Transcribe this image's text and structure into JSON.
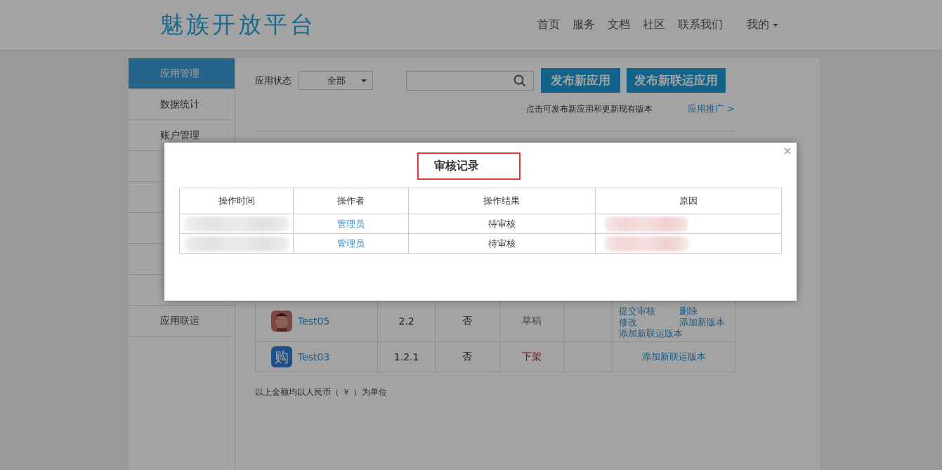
{
  "header": {
    "logo": "魅族开放平台",
    "nav": [
      {
        "label": "首页"
      },
      {
        "label": "服务"
      },
      {
        "label": "文档"
      },
      {
        "label": "社区"
      },
      {
        "label": "联系我们"
      },
      {
        "label": "我的",
        "dropdown": true
      }
    ]
  },
  "sidebar": {
    "items": [
      {
        "label": "应用管理",
        "selected": true
      },
      {
        "label": "数据统计",
        "selected": false
      },
      {
        "label": "账户管理",
        "selected": false
      },
      {
        "selected": false
      },
      {
        "selected": false
      },
      {
        "selected": false
      },
      {
        "selected": false
      },
      {
        "selected": false
      },
      {
        "label": "应用联运",
        "selected": false
      }
    ]
  },
  "toolbar": {
    "status_label": "应用状态",
    "status_value": "全部",
    "buttons": [
      "发布新应用",
      "发布新联运应用"
    ],
    "hint": "点击可发布新应用和更新现有版本",
    "promo_link": "应用推广 >"
  },
  "apps": [
    {
      "kind": "character",
      "name": "Test05",
      "version": "2.2",
      "column_3": "否",
      "status": {
        "text": "草稿",
        "kind": "draft"
      },
      "actions": [
        "提交审核",
        "删除",
        "修改",
        "添加新版本",
        "添加新联运版本"
      ]
    },
    {
      "kind": "glyph",
      "icon_text": "购",
      "name": "Test03",
      "version": "1.2.1",
      "column_3": "否",
      "status": {
        "text": "下架",
        "kind": "offline"
      },
      "actions": [
        "添加新联运版本"
      ]
    }
  ],
  "footnote": "以上金额均以人民币（ ￥ ）为单位",
  "modal": {
    "title": "审核记录",
    "title_highlighted": true,
    "columns": [
      "操作时间",
      "操作者",
      "操作结果",
      "原因"
    ],
    "rows": [
      {
        "time_redacted": true,
        "operator": "管理员",
        "result": "待审核",
        "reason_redacted": true
      },
      {
        "time_redacted": true,
        "operator": "管理员",
        "result": "待审核",
        "reason_redacted": true
      }
    ]
  }
}
